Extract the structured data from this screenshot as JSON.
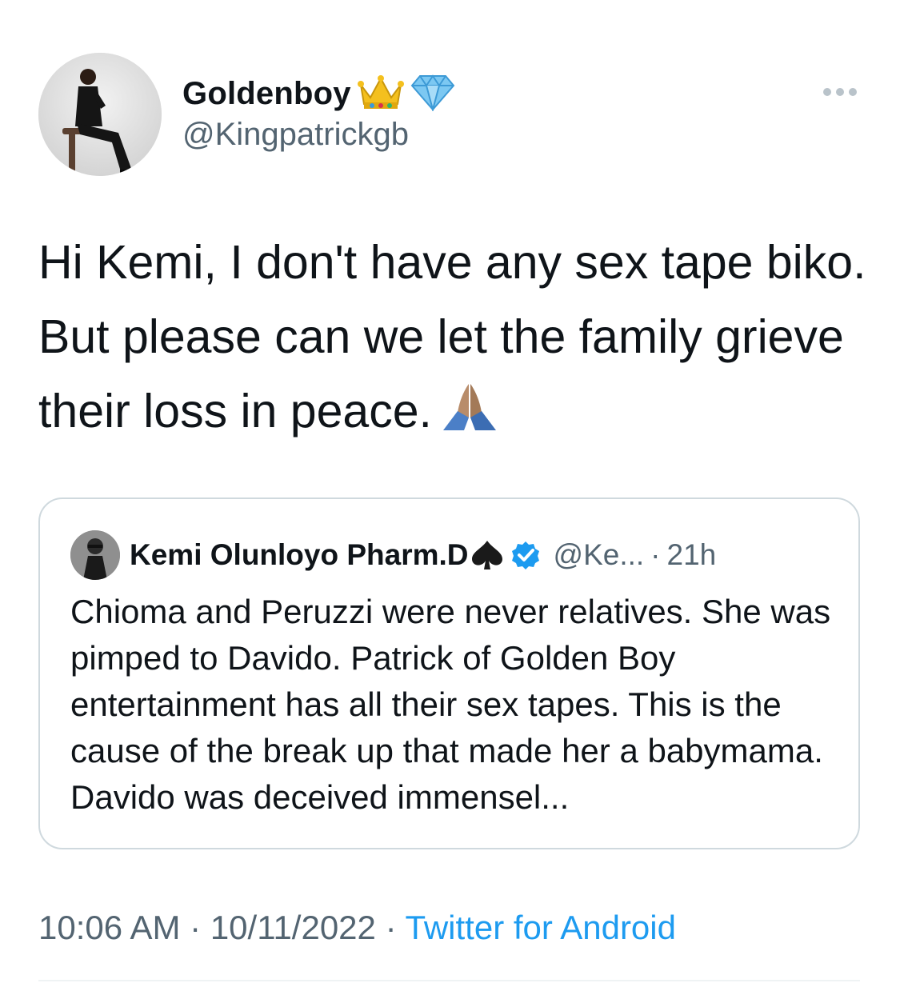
{
  "author": {
    "display_name": "Goldenboy",
    "handle": "@Kingpatrickgb",
    "badges": [
      "crown-emoji",
      "gem-emoji"
    ]
  },
  "tweet": {
    "text": "Hi Kemi, I don't have any sex tape biko. But please can we let the family grieve their loss in peace.",
    "trailing_emoji": "folded-hands-emoji"
  },
  "quoted_tweet": {
    "display_name": "Kemi Olunloyo Pharm.D",
    "name_emoji": "spade-suit",
    "verified": true,
    "handle": "@Ke...",
    "separator": "·",
    "time_ago": "21h",
    "text": "Chioma and Peruzzi were never relatives. She was pimped to Davido. Patrick of Golden Boy entertainment has all their sex tapes. This is the cause of the break up that made her a babymama. Davido was deceived immensel..."
  },
  "footer": {
    "time": "10:06 AM",
    "separator": "·",
    "date": "10/11/2022",
    "separator2": "·",
    "source": "Twitter for Android"
  },
  "colors": {
    "secondary_text": "#536471",
    "link": "#1d9bf0",
    "verified": "#1d9bf0",
    "border": "#cfd9de"
  }
}
